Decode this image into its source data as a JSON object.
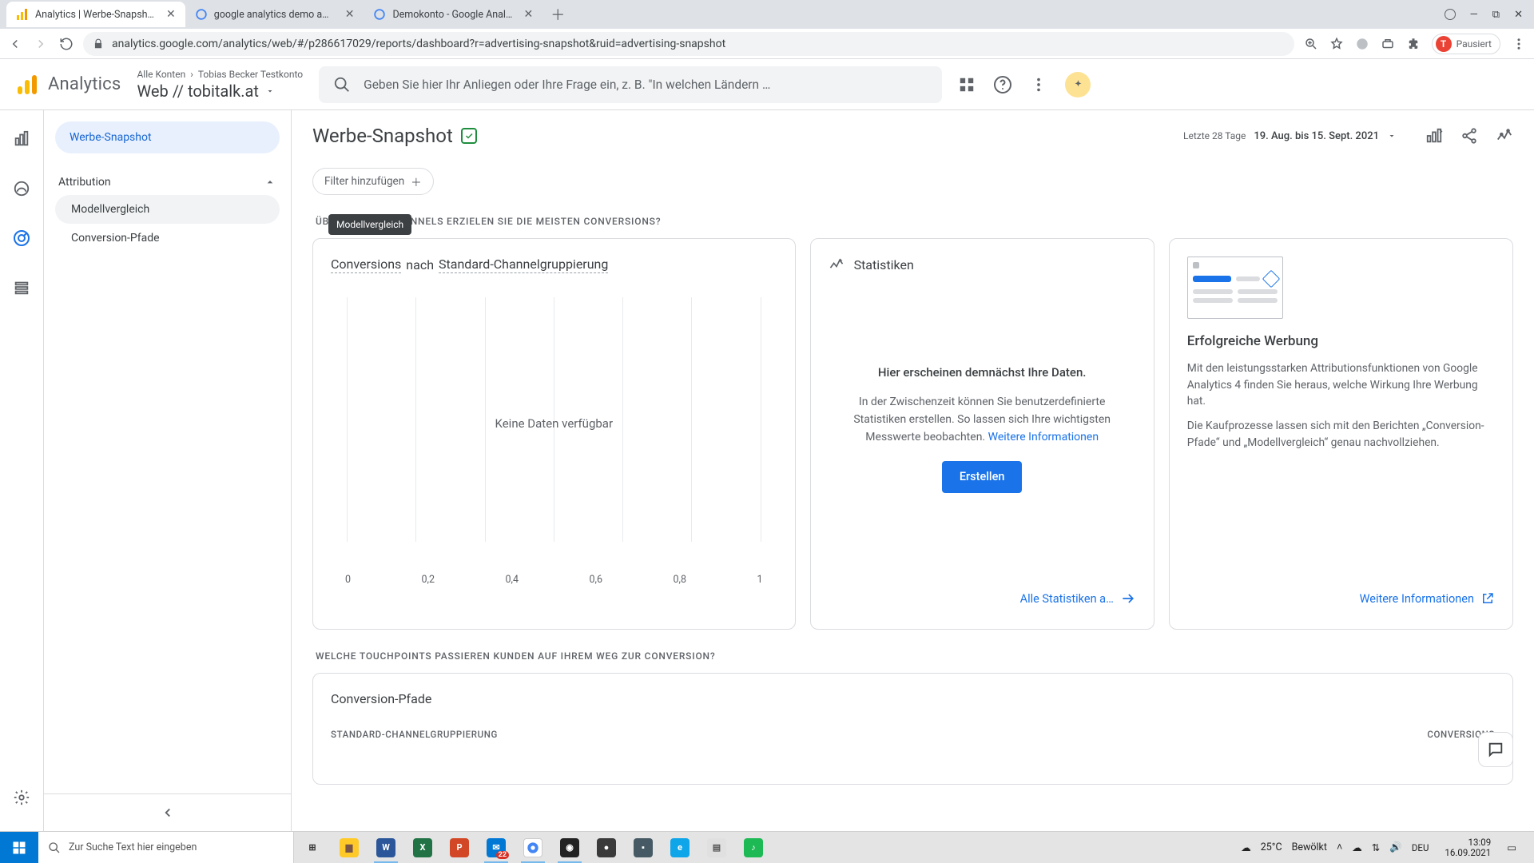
{
  "browser": {
    "tabs": [
      {
        "title": "Analytics | Werbe-Snapshot",
        "active": true,
        "favicon": "ga"
      },
      {
        "title": "google analytics demo account",
        "active": false,
        "favicon": "g"
      },
      {
        "title": "Demokonto - Google Analytics-…",
        "active": false,
        "favicon": "g"
      }
    ],
    "url": "analytics.google.com/analytics/web/#/p286617029/reports/dashboard?r=advertising-snapshot&ruid=advertising-snapshot",
    "profile_label": "Pausiert",
    "profile_initial": "T"
  },
  "ga": {
    "product": "Analytics",
    "crumb_label": "Alle Konten",
    "crumb_account": "Tobias Becker Testkonto",
    "crumb_property": "Web // tobitalk.at",
    "search_placeholder": "Geben Sie hier Ihr Anliegen oder Ihre Frage ein, z. B. \"In welchen Ländern …"
  },
  "side": {
    "active_item": "Werbe-Snapshot",
    "section": "Attribution",
    "sub": [
      "Modellvergleich",
      "Conversion-Pfade"
    ],
    "tooltip": "Modellvergleich"
  },
  "page": {
    "title": "Werbe-Snapshot",
    "date_prefix": "Letzte 28 Tage",
    "date_range": "19. Aug. bis 15. Sept. 2021",
    "filter_label": "Filter hinzufügen",
    "section1": "ÜBER WELCHE CHANNELS ERZIELEN SIE DIE MEISTEN CONVERSIONS?",
    "section2": "WELCHE TOUCHPOINTS PASSIEREN KUNDEN AUF IHREM WEG ZUR CONVERSION?",
    "section2_card_title": "Conversion-Pfade",
    "section2_col_left": "STANDARD-CHANNELGRUPPIERUNG",
    "section2_col_right": "CONVERSIONS"
  },
  "card_chart": {
    "title_pre": "Conversions",
    "title_mid": " nach ",
    "title_suf": "Standard-Channelgruppierung",
    "no_data": "Keine Daten verfügbar"
  },
  "chart_data": {
    "type": "bar",
    "categories": [],
    "values": [],
    "xticks": [
      "0",
      "0,2",
      "0,4",
      "0,6",
      "0,8",
      "1"
    ],
    "xlim": [
      0,
      1
    ],
    "title": "Conversions nach Standard-Channelgruppierung",
    "note": "Keine Daten verfügbar"
  },
  "card_stats": {
    "title": "Statistiken",
    "headline": "Hier erscheinen demnächst Ihre Daten.",
    "desc": "In der Zwischenzeit können Sie benutzerdefinierte Statistiken erstellen. So lassen sich Ihre wichtigsten Messwerte beobachten.",
    "link": "Weitere Informationen",
    "button": "Erstellen",
    "footer": "Alle Statistiken a…"
  },
  "card_promo": {
    "title": "Erfolgreiche Werbung",
    "p1": "Mit den leistungsstarken Attributionsfunktionen von Google Analytics 4 finden Sie heraus, welche Wirkung Ihre Werbung hat.",
    "p2": "Die Kaufprozesse lassen sich mit den Berichten „Conversion-Pfade“ und „Modellvergleich“ genau nachvollziehen.",
    "footer": "Weitere Informationen"
  },
  "taskbar": {
    "search_placeholder": "Zur Suche Text hier eingeben",
    "weather_temp": "25°C",
    "weather_label": "Bewölkt",
    "lang": "DEU",
    "time": "13:09",
    "date": "16.09.2021",
    "mail_badge": "22"
  }
}
